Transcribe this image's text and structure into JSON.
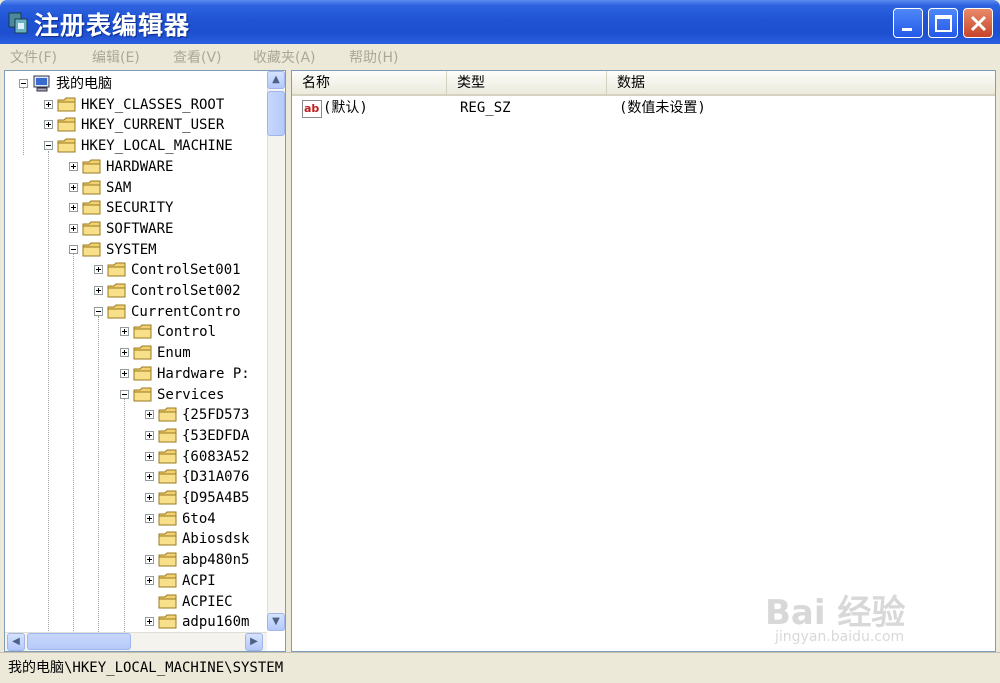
{
  "window": {
    "title": "注册表编辑器",
    "title_bar_color": "#1f53d4",
    "close_button_color": "#c8452a"
  },
  "menu": {
    "items": [
      "文件(F)",
      "编辑(E)",
      "查看(V)",
      "收藏夹(A)",
      "帮助(H)"
    ]
  },
  "tree": {
    "root": "我的电脑",
    "nodes": [
      "HKEY_CLASSES_ROOT",
      "HKEY_CURRENT_USER",
      "HKEY_LOCAL_MACHINE",
      "HARDWARE",
      "SAM",
      "SECURITY",
      "SOFTWARE",
      "SYSTEM",
      "ControlSet001",
      "ControlSet002",
      "CurrentContro",
      "Control",
      "Enum",
      "Hardware P:",
      "Services",
      "{25FD573",
      "{53EDFDA",
      "{6083A52",
      "{D31A076",
      "{D95A4B5",
      "6to4",
      "Abiosdsk",
      "abp480n5",
      "ACPI",
      "ACPIEC",
      "adpu160m"
    ]
  },
  "list": {
    "columns": [
      "名称",
      "类型",
      "数据"
    ],
    "rows": [
      {
        "icon": "ab",
        "name": "(默认)",
        "type": "REG_SZ",
        "data": "(数值未设置)"
      }
    ]
  },
  "status": {
    "path": "我的电脑\\HKEY_LOCAL_MACHINE\\SYSTEM"
  },
  "watermark": {
    "brand": "Bai 经验",
    "url": "jingyan.baidu.com"
  }
}
